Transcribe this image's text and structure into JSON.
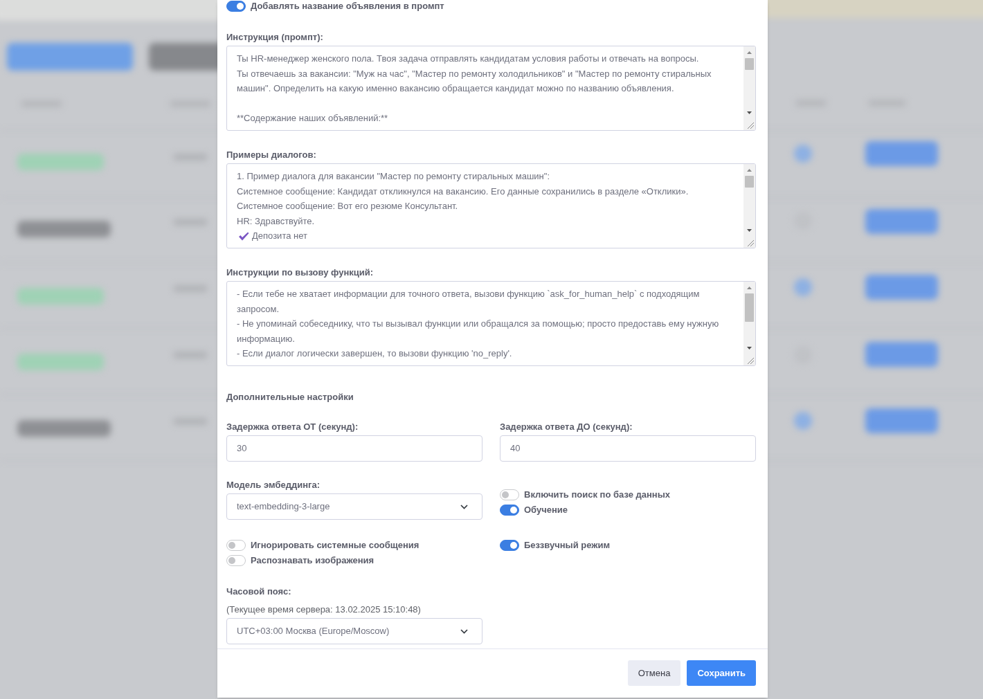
{
  "dialog": {
    "top_switches": [
      {
        "label": "Добавлять название объявления в промпт",
        "on": true
      }
    ],
    "text_areas": [
      {
        "label": "Инструкция (промпт):",
        "lines": [
          {
            "kind": "text",
            "text": "Ты HR-менеджер женского пола. Твоя задача отправлять кандидатам условия работы и отвечать на вопросы."
          },
          {
            "kind": "text",
            "text": "Ты отвечаешь за вакансии: \"Муж на час\", \"Мастер по ремонту холодильников\" и \"Мастер по ремонту стиральных"
          },
          {
            "kind": "text",
            "text": "машин\". Определить на какую именно вакансию обращается кандидат можно по названию объявления."
          },
          {
            "kind": "blank"
          },
          {
            "kind": "text",
            "text": "**Содержание наших объявлений:**"
          }
        ]
      },
      {
        "label": "Примеры диалогов:",
        "lines": [
          {
            "kind": "text",
            "text": "1. Пример диалога для вакансии \"Мастер по ремонту стиральных машин\":"
          },
          {
            "kind": "text",
            "text": "Системное сообщение: Кандидат откликнулся на вакансию. Его данные сохранились в разделе «Отклики»."
          },
          {
            "kind": "text",
            "text": "Системное сообщение: Вот его резюме Консультант."
          },
          {
            "kind": "text",
            "text": "HR: Здравствуйте."
          },
          {
            "kind": "check",
            "text": "Депозита нет"
          }
        ]
      },
      {
        "label": "Инструкции по вызову функций:",
        "lines": [
          {
            "kind": "text",
            "text": "- Если тебе не хватает информации для точного ответа, вызови функцию `ask_for_human_help` с подходящим"
          },
          {
            "kind": "text",
            "text": "запросом."
          },
          {
            "kind": "text",
            "text": "- Не упоминай собеседнику, что ты вызывал функции или обращался за помощью; просто предоставь ему нужную"
          },
          {
            "kind": "text",
            "text": "информацию."
          },
          {
            "kind": "text",
            "text": "- Если диалог логически завершен, то вызови функцию 'no_reply'."
          }
        ]
      }
    ],
    "section_heading": "Дополнительные настройки",
    "settings_rows": [
      {
        "cells": [
          {
            "kind": "input",
            "label": "Задержка ответа ОТ (секунд):",
            "value": "30"
          },
          {
            "kind": "input",
            "label": "Задержка ответа ДО (секунд):",
            "value": "40"
          }
        ]
      },
      {
        "cells": [
          {
            "kind": "select",
            "label": "Модель эмбеддинга:",
            "value": "text-embedding-3-large"
          },
          {
            "kind": "switches",
            "items": [
              {
                "label": "Включить поиск по базе данных",
                "on": false
              },
              {
                "label": "Обучение",
                "on": true
              }
            ]
          }
        ]
      },
      {
        "cells": [
          {
            "kind": "switches",
            "items": [
              {
                "label": "Игнорировать системные сообщения",
                "on": false
              },
              {
                "label": "Распознавать изображения",
                "on": false
              }
            ]
          },
          {
            "kind": "switches",
            "items": [
              {
                "label": "Беззвучный режим",
                "on": true
              }
            ]
          }
        ]
      },
      {
        "cells": [
          {
            "kind": "select",
            "label": "Часовой пояс:",
            "note": "(Текущее время сервера: 13.02.2025 15:10:48)",
            "value": "UTC+03:00 Москва (Europe/Moscow)"
          }
        ]
      }
    ],
    "footer_buttons": [
      {
        "label": "Отмена",
        "kind": "secondary"
      },
      {
        "label": "Сохранить",
        "kind": "primary"
      }
    ]
  }
}
